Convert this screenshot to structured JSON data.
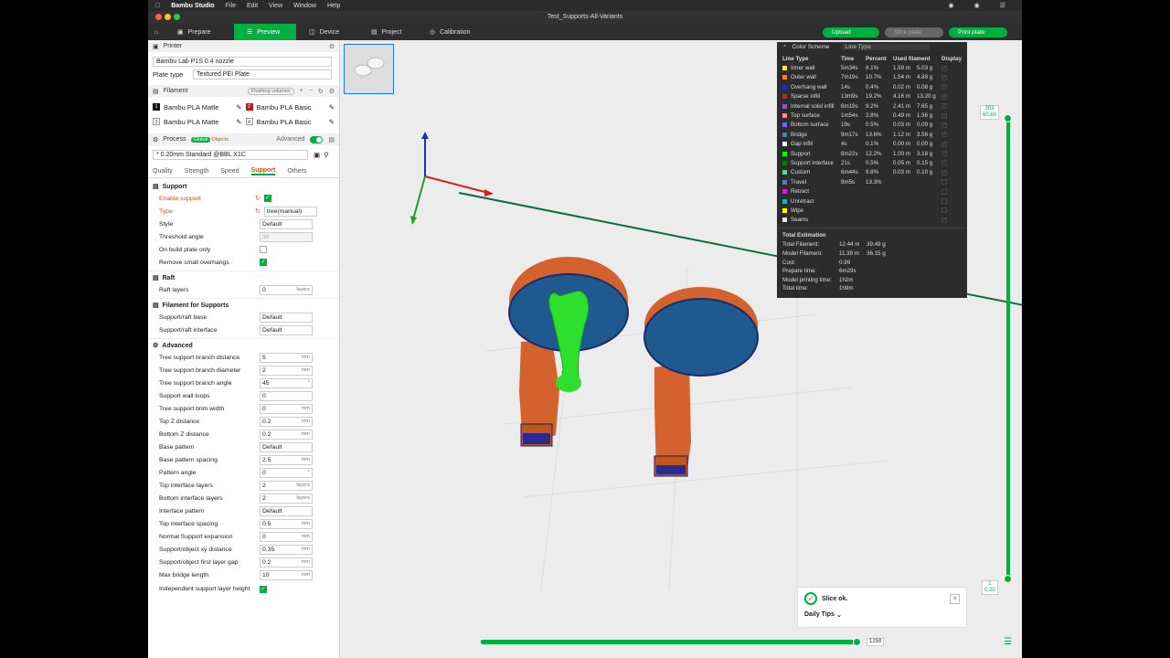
{
  "menubar": {
    "app_name": "Bambu Studio",
    "items": [
      "File",
      "Edit",
      "View",
      "Window",
      "Help"
    ]
  },
  "window": {
    "title": "Test_Supports-All-Variants"
  },
  "nav": {
    "tabs": [
      "Prepare",
      "Preview",
      "Device",
      "Project",
      "Calibration"
    ],
    "active_tab": "Preview",
    "upload": "Upload",
    "slice_plate": "Slice plate",
    "print_plate": "Print plate"
  },
  "printer": {
    "section": "Printer",
    "name": "Bambu Lab P1S 0.4 nozzle",
    "plate_type_label": "Plate type",
    "plate_type": "Textured PEI Plate"
  },
  "filament": {
    "section": "Filament",
    "flushing": "Flushing volumes",
    "items": [
      {
        "num": "1",
        "name": "Bambu PLA Matte",
        "color": "#111111"
      },
      {
        "num": "2",
        "name": "Bambu PLA Basic",
        "color": "#c0161b"
      },
      {
        "num": "3",
        "name": "Bambu PLA Matte",
        "color": "#ffffff"
      },
      {
        "num": "4",
        "name": "Bambu PLA Basic",
        "color": "#ffffff"
      }
    ]
  },
  "process": {
    "section": "Process",
    "global": "Global",
    "objects": "Objects",
    "advanced": "Advanced",
    "profile": "* 0.20mm Standard @BBL X1C",
    "tabs": [
      "Quality",
      "Strength",
      "Speed",
      "Support",
      "Others"
    ],
    "active_tab": "Support"
  },
  "support": {
    "group": "Support",
    "enable_support": "Enable support",
    "type_label": "Type",
    "type_value": "tree(manual)",
    "style_label": "Style",
    "style_value": "Default",
    "threshold_label": "Threshold angle",
    "threshold_value": "30",
    "on_build_plate": "On build plate only",
    "remove_small": "Remove small overhangs"
  },
  "raft": {
    "group": "Raft",
    "layers_label": "Raft layers",
    "layers_value": "0",
    "layers_unit": "layers"
  },
  "filament_supports": {
    "group": "Filament for Supports",
    "base_label": "Support/raft base",
    "base_value": "Default",
    "interface_label": "Support/raft interface",
    "interface_value": "Default"
  },
  "advanced": {
    "group": "Advanced",
    "params": [
      {
        "label": "Tree support branch distance",
        "value": "5",
        "unit": "mm"
      },
      {
        "label": "Tree support branch diameter",
        "value": "2",
        "unit": "mm"
      },
      {
        "label": "Tree support branch angle",
        "value": "45",
        "unit": "°"
      },
      {
        "label": "Support wall loops",
        "value": "0",
        "unit": ""
      },
      {
        "label": "Tree support brim width",
        "value": "0",
        "unit": "mm"
      },
      {
        "label": "Top Z distance",
        "value": "0.2",
        "unit": "mm"
      },
      {
        "label": "Bottom Z distance",
        "value": "0.2",
        "unit": "mm"
      },
      {
        "label": "Base pattern",
        "value": "Default",
        "unit": ""
      },
      {
        "label": "Base pattern spacing",
        "value": "2.5",
        "unit": "mm"
      },
      {
        "label": "Pattern angle",
        "value": "0",
        "unit": "°"
      },
      {
        "label": "Top interface layers",
        "value": "2",
        "unit": "layers"
      },
      {
        "label": "Bottom interface layers",
        "value": "2",
        "unit": "layers"
      },
      {
        "label": "Interface pattern",
        "value": "Default",
        "unit": ""
      },
      {
        "label": "Top interface spacing",
        "value": "0.5",
        "unit": "mm"
      },
      {
        "label": "Normal Support expansion",
        "value": "0",
        "unit": "mm"
      },
      {
        "label": "Support/object xy distance",
        "value": "0.35",
        "unit": "mm"
      },
      {
        "label": "Support/object first layer gap",
        "value": "0.2",
        "unit": "mm"
      },
      {
        "label": "Max bridge length",
        "value": "10",
        "unit": "mm"
      }
    ],
    "independent_label": "Independent support layer height"
  },
  "legend": {
    "title": "Color Scheme",
    "scheme": "Line Type",
    "headers": [
      "Line Type",
      "Time",
      "Percent",
      "Used filament",
      "Display"
    ],
    "rows": [
      {
        "name": "Inner wall",
        "color": "#ffe64d",
        "time": "5m34s",
        "pct": "8.1%",
        "len": "1.59 m",
        "wt": "5.03 g",
        "shown": true
      },
      {
        "name": "Outer wall",
        "color": "#ff7d38",
        "time": "7m19s",
        "pct": "10.7%",
        "len": "1.54 m",
        "wt": "4.89 g",
        "shown": true
      },
      {
        "name": "Overhang wall",
        "color": "#1f1fff",
        "time": "14s",
        "pct": "0.4%",
        "len": "0.02 m",
        "wt": "0.08 g",
        "shown": true
      },
      {
        "name": "Sparse infill",
        "color": "#b03029",
        "time": "13m9s",
        "pct": "19.2%",
        "len": "4.16 m",
        "wt": "13.20 g",
        "shown": true
      },
      {
        "name": "Internal solid infill",
        "color": "#9654cc",
        "time": "6m19s",
        "pct": "9.2%",
        "len": "2.41 m",
        "wt": "7.65 g",
        "shown": true
      },
      {
        "name": "Top surface",
        "color": "#ff8c8c",
        "time": "1m54s",
        "pct": "2.8%",
        "len": "0.49 m",
        "wt": "1.56 g",
        "shown": true
      },
      {
        "name": "Bottom surface",
        "color": "#6666ff",
        "time": "19s",
        "pct": "0.5%",
        "len": "0.03 m",
        "wt": "0.09 g",
        "shown": true
      },
      {
        "name": "Bridge",
        "color": "#4d80ba",
        "time": "9m17s",
        "pct": "13.6%",
        "len": "1.12 m",
        "wt": "3.56 g",
        "shown": true
      },
      {
        "name": "Gap infill",
        "color": "#ffffff",
        "time": "4s",
        "pct": "0.1%",
        "len": "0.00 m",
        "wt": "0.00 g",
        "shown": true
      },
      {
        "name": "Support",
        "color": "#00ff00",
        "time": "8m22s",
        "pct": "12.2%",
        "len": "1.00 m",
        "wt": "3.18 g",
        "shown": true
      },
      {
        "name": "Support interface",
        "color": "#008000",
        "time": "21s",
        "pct": "0.5%",
        "len": "0.05 m",
        "wt": "0.15 g",
        "shown": true
      },
      {
        "name": "Custom",
        "color": "#5ed194",
        "time": "6m44s",
        "pct": "9.8%",
        "len": "0.03 m",
        "wt": "0.10 g",
        "shown": true
      },
      {
        "name": "Travel",
        "color": "#4d80ba",
        "time": "9m5s",
        "pct": "13.3%",
        "len": "",
        "wt": "",
        "shown": false
      },
      {
        "name": "Retract",
        "color": "#ff00ff",
        "time": "",
        "pct": "",
        "len": "",
        "wt": "",
        "shown": false
      },
      {
        "name": "Unretract",
        "color": "#1bb1b1",
        "time": "",
        "pct": "",
        "len": "",
        "wt": "",
        "shown": false
      },
      {
        "name": "Wipe",
        "color": "#ffff00",
        "time": "",
        "pct": "",
        "len": "",
        "wt": "",
        "shown": false
      },
      {
        "name": "Seams",
        "color": "#e6e6e6",
        "time": "",
        "pct": "",
        "len": "",
        "wt": "",
        "shown": true
      }
    ],
    "total_title": "Total Estimation",
    "totals": [
      {
        "k": "Total Filament:",
        "v1": "12.44 m",
        "v2": "39.49 g"
      },
      {
        "k": "Model Filament:",
        "v1": "11.39 m",
        "v2": "36.15 g"
      },
      {
        "k": "Cost:",
        "v1": "0.99",
        "v2": ""
      },
      {
        "k": "Prepare time:",
        "v1": "6m29s",
        "v2": ""
      },
      {
        "k": "Model printing time:",
        "v1": "1h2m",
        "v2": ""
      },
      {
        "k": "Total time:",
        "v1": "1h9m",
        "v2": ""
      }
    ]
  },
  "slider": {
    "top_layer": "303",
    "top_height": "60.60",
    "bottom_layer": "1",
    "bottom_height": "0.20",
    "horizontal_value": "1258"
  },
  "toast": {
    "message": "Slice ok.",
    "tips": "Daily Tips"
  },
  "colors": {
    "accent": "#00ae42",
    "orange": "#c4551a"
  }
}
